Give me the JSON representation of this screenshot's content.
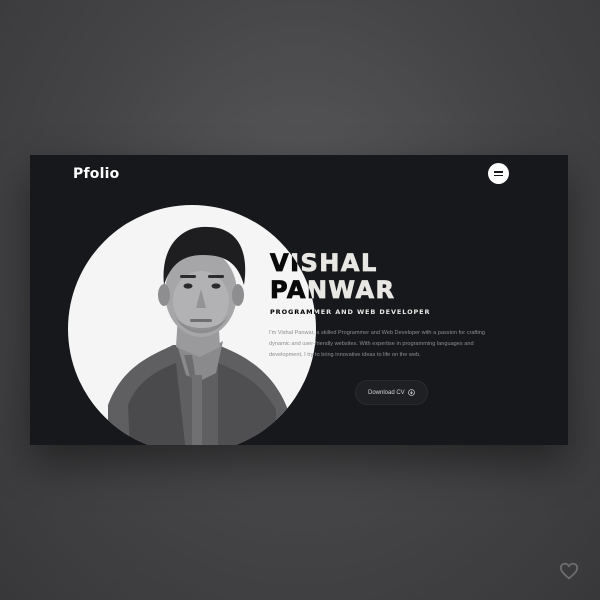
{
  "header": {
    "logo": "Pfolio",
    "menu_icon": "hamburger-menu-icon"
  },
  "hero": {
    "name_line1": "VISHAL",
    "name_line2": "PANWAR",
    "role": "PROGRAMMER AND WEB DEVELOPER",
    "bio_line1": "I'm Vishal Panwar, a skilled Programmer and Web Developer with a passion for crafting",
    "bio_line2": "dynamic and user-friendly websites. With expertise in programming languages and",
    "bio_line3": "development, I try to bring innovative ideas to life on the web.",
    "photo_icon": "portrait-photo",
    "cta_label": "Download CV",
    "cta_icon": "download-icon"
  },
  "colors": {
    "page_bg": "#444446",
    "card_bg": "#17181b",
    "text": "#ffffff",
    "muted": "#8d8e93"
  },
  "corner_icon": "heart-icon"
}
